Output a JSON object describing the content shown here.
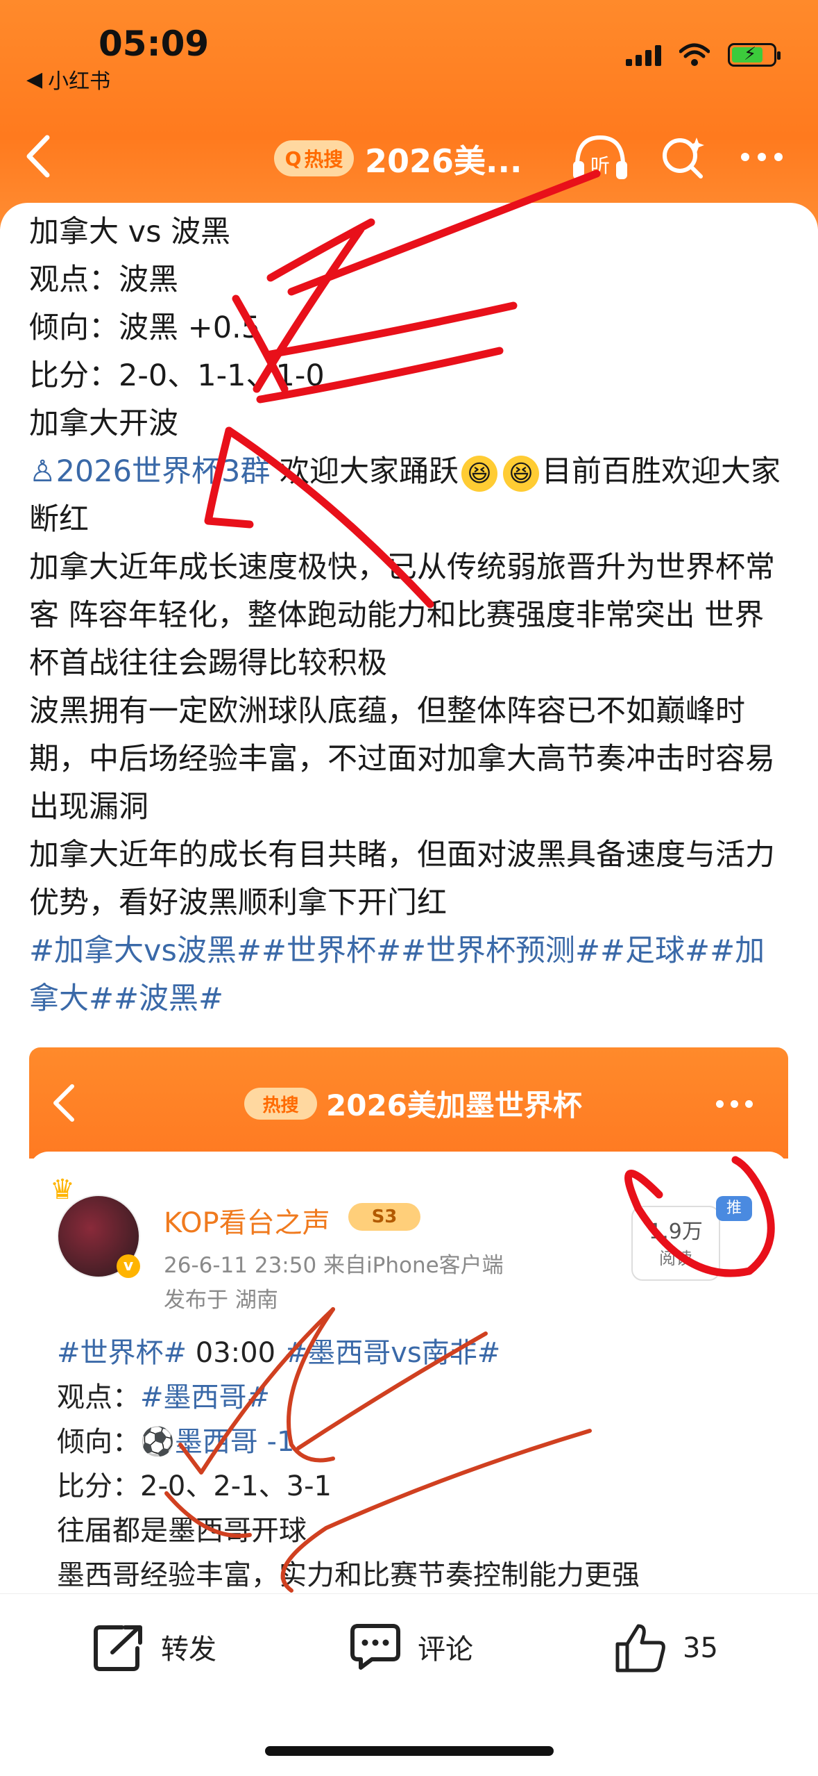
{
  "status": {
    "time": "05:09",
    "back_app": "小红书"
  },
  "nav": {
    "hot_badge": "热搜",
    "title": "2026美..."
  },
  "post": {
    "lines": [
      "加拿大 vs 波黑",
      "观点：波黑",
      "倾向：波黑 +0.5",
      "比分：2-0、1-1、1-0",
      "加拿大开波"
    ],
    "group_link": "2026世界杯3群",
    "group_text": " 欢迎大家踊跃",
    "group_text2": "目前百胜欢迎大家断红",
    "body": [
      "加拿大近年成长速度极快，已从传统弱旅晋升为世界杯常客 阵容年轻化，整体跑动能力和比赛强度非常突出 世界杯首战往往会踢得比较积极",
      "波黑拥有一定欧洲球队底蕴，但整体阵容已不如巅峰时期，中后场经验丰富，不过面对加拿大高节奏冲击时容易出现漏洞",
      "加拿大近年的成长有目共睹，但面对波黑具备速度与活力优势，看好波黑顺利拿下开门红"
    ],
    "tags": "#加拿大vs波黑##世界杯##世界杯预测##足球##加拿大##波黑#"
  },
  "embed": {
    "hot_badge": "热搜",
    "title": "2026美加墨世界杯",
    "username": "KOP看台之声",
    "level": "S3",
    "meta": "26-6-11 23:50  来自iPhone客户端",
    "location": "发布于 湖南",
    "reads": "1.9万",
    "reads_label": "阅读",
    "tui": "推",
    "line1_tag1": "#世界杯#",
    "line1_time": " 03:00 ",
    "line1_tag2": "#墨西哥vs南非#",
    "view_label": "观点：",
    "view_tag": "#墨西哥#",
    "lean_label": "倾向：",
    "lean_value": "墨西哥 -1",
    "score": "比分：2-0、2-1、3-1",
    "line5": "往届都是墨西哥开球",
    "line6": "墨西哥经验丰富，实力和比赛节奏控制能力更强"
  },
  "actions": {
    "repost": "转发",
    "comment": "评论",
    "likes": "35"
  },
  "colors": {
    "orange": "#ff7a1e",
    "link_blue": "#3a69a8",
    "annotation_red": "#e8101a"
  }
}
